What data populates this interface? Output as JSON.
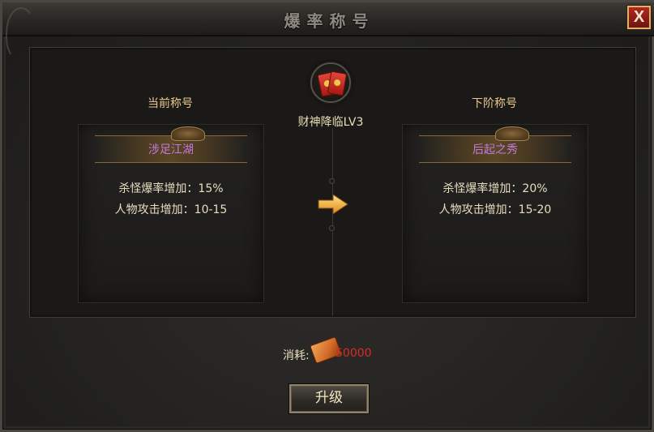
{
  "window": {
    "title": "爆率称号",
    "close_label": "X"
  },
  "current": {
    "header": "当前称号",
    "name": "涉足江湖",
    "stats": [
      "杀怪爆率增加：15%",
      "人物攻击增加：10-15"
    ]
  },
  "center": {
    "title_name": "财神降临LV3",
    "icon": "red-envelope-icon",
    "arrow_icon": "arrow-right-icon"
  },
  "next": {
    "header": "下阶称号",
    "name": "后起之秀",
    "stats": [
      "杀怪爆率增加：20%",
      "人物攻击增加：15-20"
    ]
  },
  "cost": {
    "label": "消耗:",
    "value": "50000",
    "icon": "ingot-icon"
  },
  "upgrade_button": "升级",
  "colors": {
    "title_name_purple": "#c47ad8",
    "cost_red": "#dc2a24",
    "label_gold": "#e8c98c"
  }
}
